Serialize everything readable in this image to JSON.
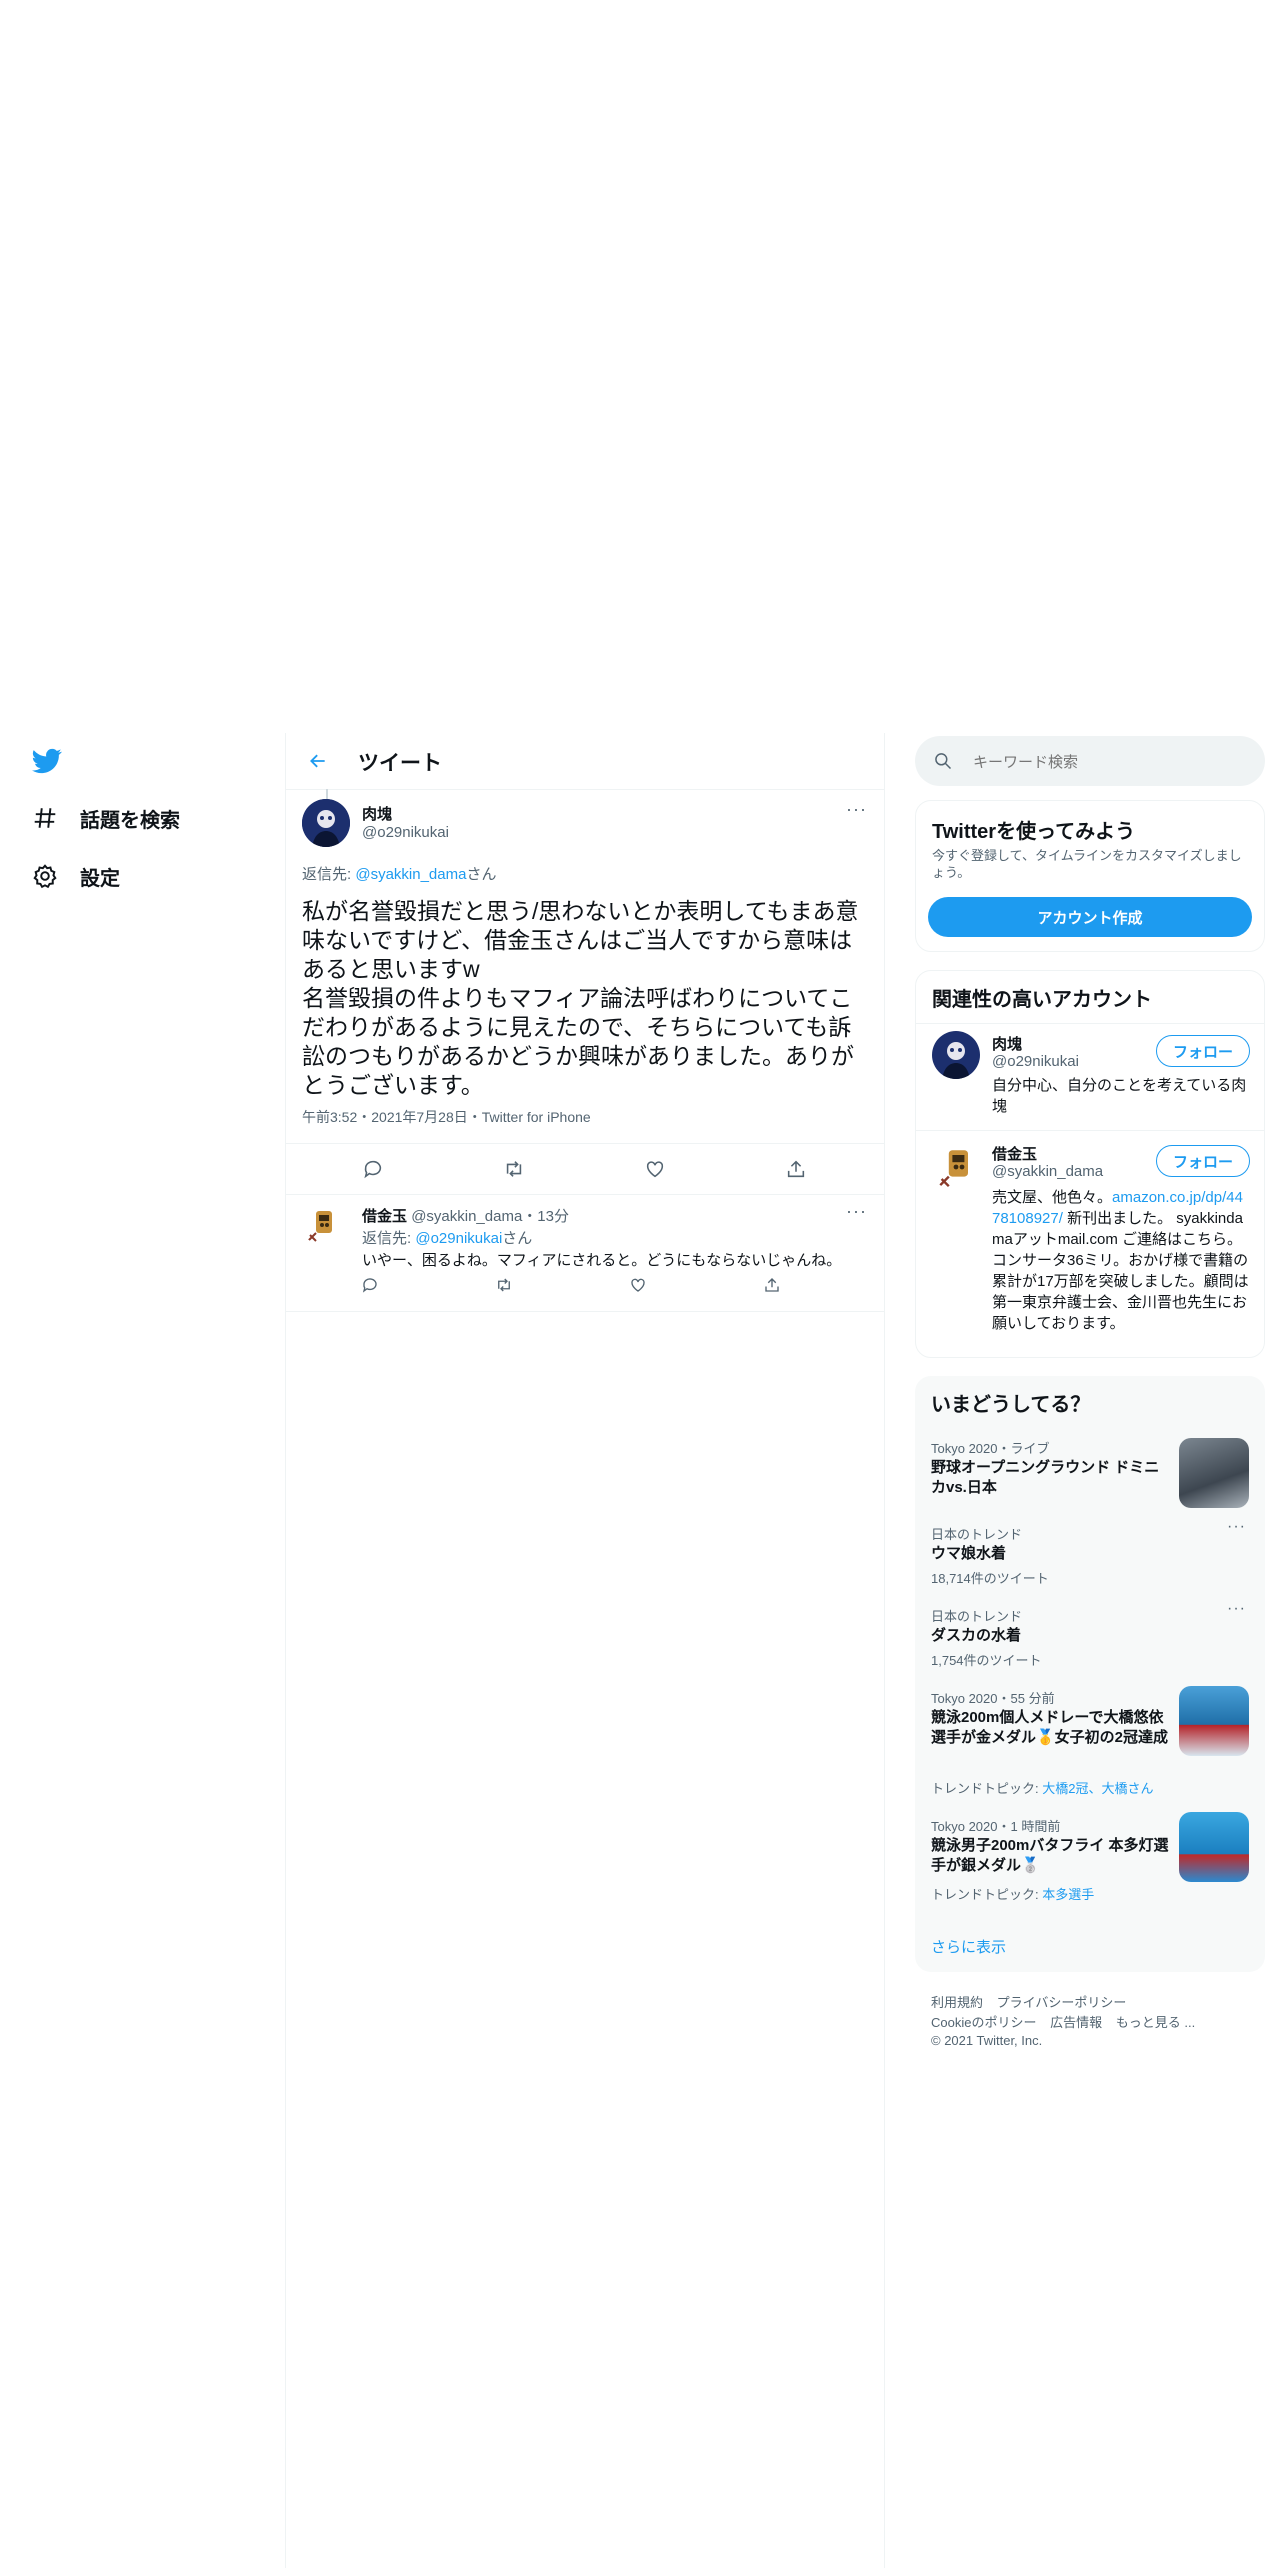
{
  "nav": {
    "logo": "twitter-bird",
    "items": [
      {
        "icon": "hashtag-icon",
        "label": "話題を検索"
      },
      {
        "icon": "gear-icon",
        "label": "設定"
      }
    ]
  },
  "header": {
    "title": "ツイート"
  },
  "tweet": {
    "name": "肉塊",
    "handle": "@o29nikukai",
    "reply_prefix": "返信先: ",
    "reply_to": "@syakkin_dama",
    "reply_suffix": "さん",
    "text": "私が名誉毀損だと思う/思わないとか表明してもまあ意味ないですけど、借金玉さんはご当人ですから意味はあると思いますw\n名誉毀損の件よりもマフィア論法呼ばわりについてこだわりがあるように見えたので、そちらについても訴訟のつもりがあるかどうか興味がありました。ありがとうございます。",
    "meta": "午前3:52・2021年7月28日・Twitter for iPhone"
  },
  "reply": {
    "name": "借金玉",
    "handle": "@syakkin_dama",
    "time": "・13分",
    "reply_prefix": "返信先: ",
    "reply_to": "@o29nikukai",
    "reply_suffix": "さん",
    "text": "いやー、困るよね。マフィアにされると。どうにもならないじゃんね。"
  },
  "search": {
    "placeholder": "キーワード検索"
  },
  "signup": {
    "title": "Twitterを使ってみよう",
    "desc": "今すぐ登録して、タイムラインをカスタマイズしましょう。",
    "button": "アカウント作成"
  },
  "related": {
    "title": "関連性の高いアカウント",
    "follow_label": "フォロー",
    "accounts": [
      {
        "name": "肉塊",
        "handle": "@o29nikukai",
        "bio": "自分中心、自分のことを考えている肉塊"
      },
      {
        "name": "借金玉",
        "handle": "@syakkin_dama",
        "bio_1": "売文屋、他色々。",
        "bio_link": "amazon.co.jp/dp/4478108927/",
        "bio_2": " 新刊出ました。 syakkindamaアットmail.com ご連絡はこちら。 コンサータ36ミリ。おかげ様で書籍の累計が17万部を突破しました。顧問は第一東京弁護士会、金川晋也先生にお願いしております。"
      }
    ]
  },
  "trends": {
    "title": "いまどうしてる？",
    "items": [
      {
        "meta": "Tokyo 2020・ライブ",
        "title": "野球オープニングラウンド ドミニカvs.日本"
      },
      {
        "meta": "日本のトレンド",
        "title": "ウマ娘水着",
        "count": "18,714件のツイート"
      },
      {
        "meta": "日本のトレンド",
        "title": "ダスカの水着",
        "count": "1,754件のツイート"
      },
      {
        "meta": "Tokyo 2020・55 分前",
        "title": "競泳200m個人メドレーで大橋悠依選手が金メダル🥇女子初の2冠達成",
        "topic_label": "トレンドトピック: ",
        "topic": "大橋2冠、大橋さん"
      },
      {
        "meta": "Tokyo 2020・1 時間前",
        "title": "競泳男子200mバタフライ 本多灯選手が銀メダル🥈",
        "topic_label": "トレンドトピック: ",
        "topic": "本多選手"
      }
    ],
    "show_more": "さらに表示"
  },
  "footer": {
    "links_row1": [
      "利用規約",
      "プライバシーポリシー"
    ],
    "links_row2": [
      "Cookieのポリシー",
      "広告情報",
      "もっと見る ..."
    ],
    "copyright": "© 2021 Twitter, Inc."
  },
  "colors": {
    "accent": "#1d9bf0",
    "text": "#0f1419",
    "muted": "#536471",
    "border": "#eff3f4"
  }
}
